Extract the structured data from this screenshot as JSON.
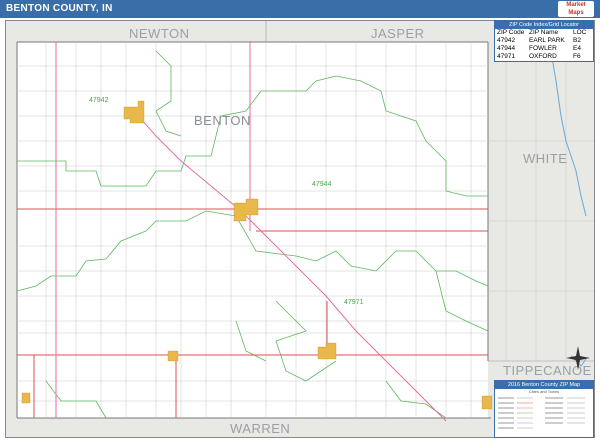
{
  "title": "BENTON COUNTY, IN",
  "logo_text": [
    "Market",
    "Maps"
  ],
  "map": {
    "county_name": "BENTON",
    "neighbors": {
      "north_west": "NEWTON",
      "north_east": "JASPER",
      "east": "WHITE",
      "south": "WARREN",
      "south_east": "TIPPECANOE"
    },
    "zip_labels": [
      "47942",
      "47944",
      "47971"
    ]
  },
  "zip_index": {
    "header": "ZIP Code Index/Grid Locator",
    "columns": [
      "ZIP Code",
      "ZIP Name",
      "LOC"
    ],
    "rows": [
      [
        "47942",
        "EARL PARK",
        "B2"
      ],
      [
        "47944",
        "FOWLER",
        "E4"
      ],
      [
        "47971",
        "OXFORD",
        "F6"
      ]
    ]
  },
  "legend": {
    "header": "2016 Benton County ZIP Map",
    "subheader": "Cities and Towns"
  },
  "colors": {
    "title_bar": "#3a6ea8",
    "road": "#d9534f",
    "highway": "#e66fa0",
    "zip_boundary": "#5cb85c",
    "town": "#e8b84a",
    "water": "#6aa9d8"
  }
}
